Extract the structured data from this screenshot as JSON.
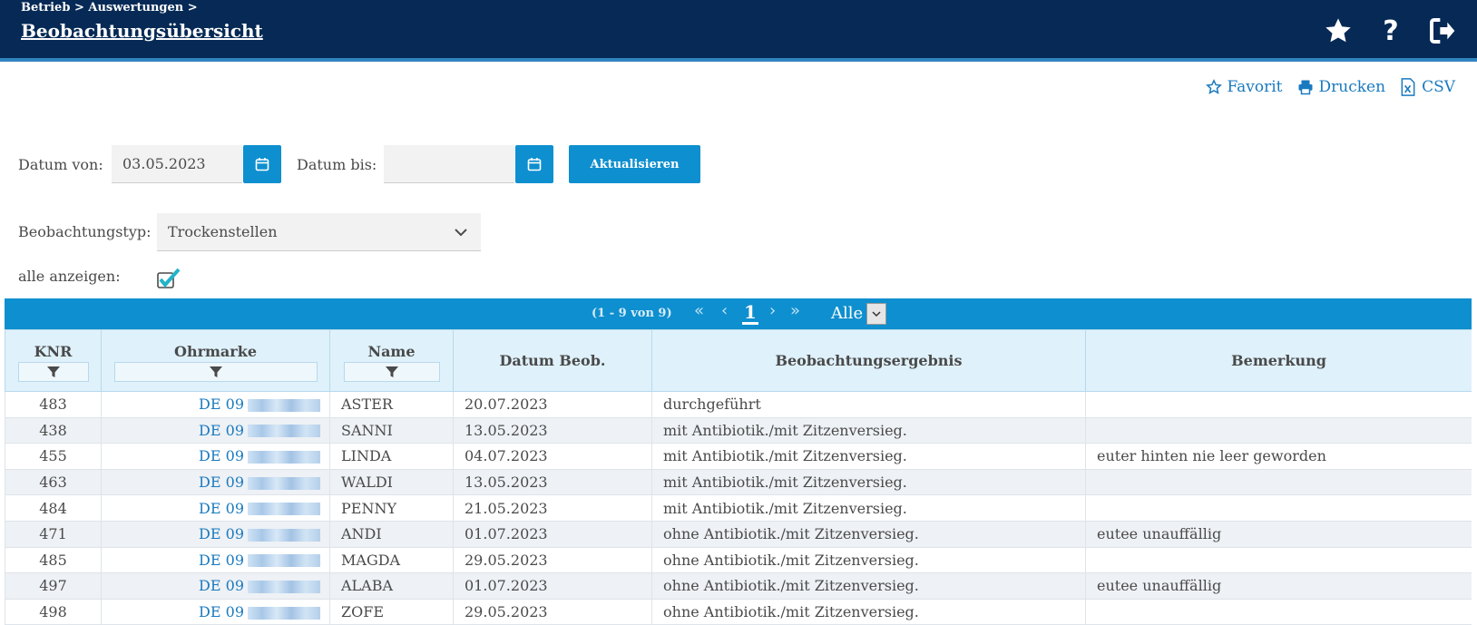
{
  "header": {
    "breadcrumb": "Betrieb > Auswertungen >",
    "title": "Beobachtungsübersicht",
    "icons": [
      "star-icon",
      "help-icon",
      "logout-icon"
    ]
  },
  "actions": {
    "favorit": "Favorit",
    "drucken": "Drucken",
    "csv": "CSV"
  },
  "filters": {
    "datum_von_label": "Datum von:",
    "datum_von_value": "03.05.2023",
    "datum_bis_label": "Datum bis:",
    "datum_bis_value": "",
    "update_button": "Aktualisieren",
    "typ_label": "Beobachtungstyp:",
    "typ_value": "Trockenstellen",
    "alle_label": "alle anzeigen:",
    "alle_checked": true
  },
  "pager": {
    "info": "(1 - 9 von 9)",
    "current_page": "1",
    "size_option": "Alle"
  },
  "table": {
    "columns": [
      "KNR",
      "Ohrmarke",
      "Name",
      "Datum Beob.",
      "Beobachtungsergebnis",
      "Bemerkung"
    ],
    "rows": [
      {
        "knr": "483",
        "ohrmarke": "DE 09",
        "name": "ASTER",
        "datum": "20.07.2023",
        "ergebnis": "durchgeführt",
        "bemerkung": ""
      },
      {
        "knr": "438",
        "ohrmarke": "DE 09",
        "name": "SANNI",
        "datum": "13.05.2023",
        "ergebnis": "mit Antibiotik./mit Zitzenversieg.",
        "bemerkung": ""
      },
      {
        "knr": "455",
        "ohrmarke": "DE 09",
        "name": "LINDA",
        "datum": "04.07.2023",
        "ergebnis": "mit Antibiotik./mit Zitzenversieg.",
        "bemerkung": "euter hinten nie leer geworden"
      },
      {
        "knr": "463",
        "ohrmarke": "DE 09",
        "name": "WALDI",
        "datum": "13.05.2023",
        "ergebnis": "mit Antibiotik./mit Zitzenversieg.",
        "bemerkung": ""
      },
      {
        "knr": "484",
        "ohrmarke": "DE 09",
        "name": "PENNY",
        "datum": "21.05.2023",
        "ergebnis": "mit Antibiotik./mit Zitzenversieg.",
        "bemerkung": ""
      },
      {
        "knr": "471",
        "ohrmarke": "DE 09",
        "name": "ANDI",
        "datum": "01.07.2023",
        "ergebnis": "ohne Antibiotik./mit Zitzenversieg.",
        "bemerkung": "eutee unauffällig"
      },
      {
        "knr": "485",
        "ohrmarke": "DE 09",
        "name": "MAGDA",
        "datum": "29.05.2023",
        "ergebnis": "ohne Antibiotik./mit Zitzenversieg.",
        "bemerkung": ""
      },
      {
        "knr": "497",
        "ohrmarke": "DE 09",
        "name": "ALABA",
        "datum": "01.07.2023",
        "ergebnis": "ohne Antibiotik./mit Zitzenversieg.",
        "bemerkung": "eutee unauffällig"
      },
      {
        "knr": "498",
        "ohrmarke": "DE 09",
        "name": "ZOFE",
        "datum": "29.05.2023",
        "ergebnis": "ohne Antibiotik./mit Zitzenversieg.",
        "bemerkung": ""
      }
    ]
  },
  "colors": {
    "header_bg": "#062a55",
    "accent": "#0e8fcf",
    "link": "#1a7abf",
    "table_header_bg": "#dff1fb",
    "row_alt_bg": "#eef1f5"
  }
}
